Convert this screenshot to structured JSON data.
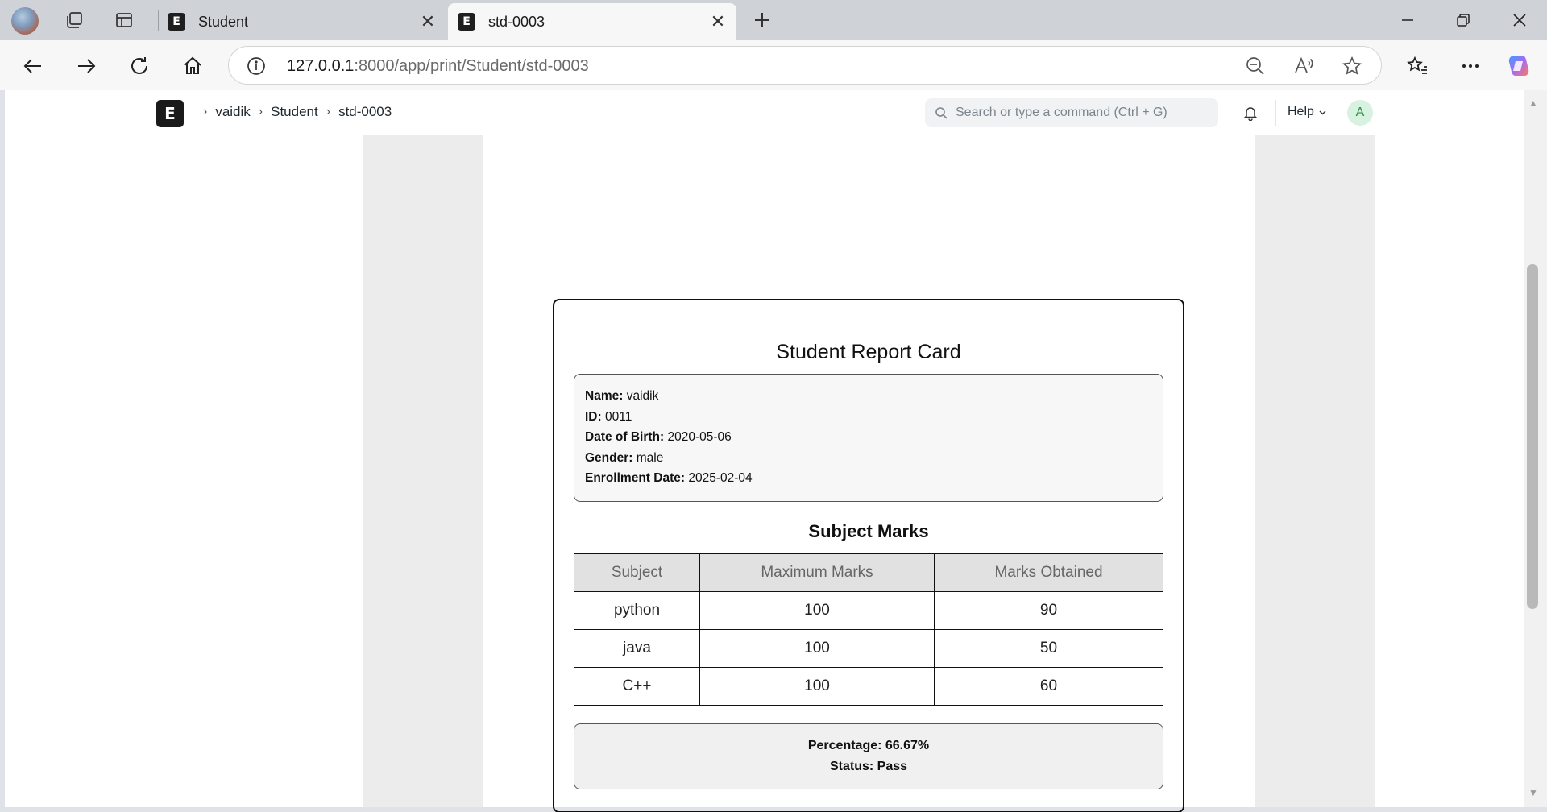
{
  "browser": {
    "tabs": [
      {
        "title": "Student",
        "favicon_letter": "E",
        "active": false
      },
      {
        "title": "std-0003",
        "favicon_letter": "E",
        "active": true
      }
    ],
    "address": {
      "host": "127.0.0.1",
      "path": ":8000/app/print/Student/std-0003"
    }
  },
  "app": {
    "logo_letter": "E",
    "breadcrumbs": [
      "vaidik",
      "Student",
      "std-0003"
    ],
    "search_placeholder": "Search or type a command (Ctrl + G)",
    "help_label": "Help",
    "avatar_initial": "A"
  },
  "report": {
    "title": "Student Report Card",
    "info": [
      {
        "label": "Name:",
        "value": "vaidik"
      },
      {
        "label": "ID:",
        "value": "0011"
      },
      {
        "label": "Date of Birth:",
        "value": "2020-05-06"
      },
      {
        "label": "Gender:",
        "value": "male"
      },
      {
        "label": "Enrollment Date:",
        "value": "2025-02-04"
      }
    ],
    "marks_title": "Subject Marks",
    "columns": [
      "Subject",
      "Maximum Marks",
      "Marks Obtained"
    ],
    "rows": [
      [
        "python",
        "100",
        "90"
      ],
      [
        "java",
        "100",
        "50"
      ],
      [
        "C++",
        "100",
        "60"
      ]
    ],
    "percentage": "Percentage: 66.67%",
    "status": "Status: Pass"
  }
}
